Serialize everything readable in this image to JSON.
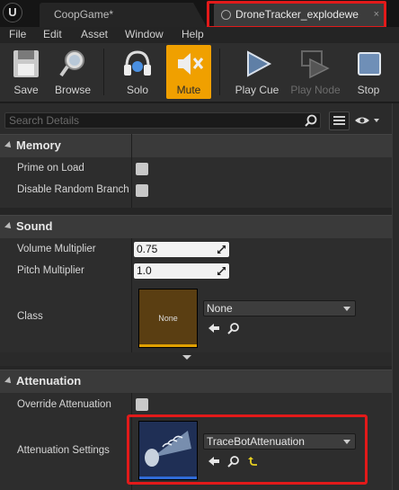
{
  "tabs": [
    {
      "label": "CoopGame*",
      "active": false
    },
    {
      "label": "DroneTracker_explodewe",
      "active": true,
      "close": "×"
    }
  ],
  "logo_text": "U",
  "menu": [
    "File",
    "Edit",
    "Asset",
    "Window",
    "Help"
  ],
  "toolbar": {
    "save": "Save",
    "browse": "Browse",
    "solo": "Solo",
    "mute": "Mute",
    "play_cue": "Play Cue",
    "play_node": "Play Node",
    "stop": "Stop"
  },
  "search": {
    "placeholder": "Search Details"
  },
  "sections": {
    "memory": {
      "title": "Memory",
      "prime_on_load": "Prime on Load",
      "disable_random_branch": "Disable Random Branch C"
    },
    "sound": {
      "title": "Sound",
      "volume_multiplier_label": "Volume Multiplier",
      "volume_multiplier_value": "0.75",
      "pitch_multiplier_label": "Pitch Multiplier",
      "pitch_multiplier_value": "1.0",
      "class_label": "Class",
      "class_thumb_text": "None",
      "class_value": "None"
    },
    "attenuation": {
      "title": "Attenuation",
      "override_label": "Override Attenuation",
      "settings_label": "Attenuation Settings",
      "settings_value": "TraceBotAttenuation"
    }
  },
  "colors": {
    "accent_orange": "#f0a000",
    "highlight_red": "#e21a1a",
    "class_thumb_bar": "#e0a000",
    "attenuation_thumb_bar": "#2f6bd8"
  },
  "icons": [
    "save-icon",
    "browse-icon",
    "solo-icon",
    "mute-icon",
    "play-cue-icon",
    "play-node-icon",
    "stop-icon",
    "search-icon",
    "view-options-icon",
    "eye-icon",
    "arrow-left-icon",
    "magnifier-icon",
    "reset-icon"
  ]
}
